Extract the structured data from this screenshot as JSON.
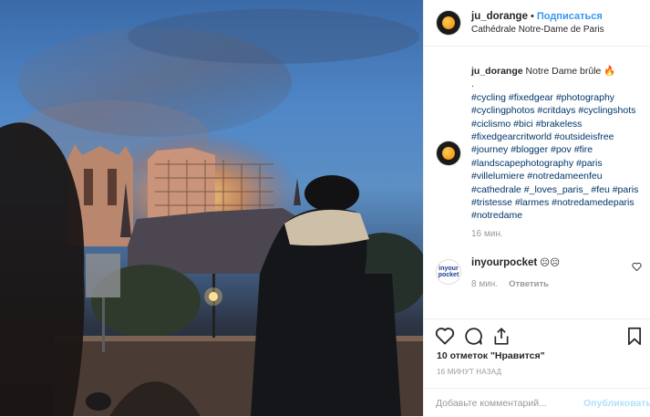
{
  "post": {
    "username": "ju_dorange",
    "separator": "•",
    "follow_label": "Подписаться",
    "location": "Cathédrale Notre-Dame de Paris"
  },
  "caption": {
    "username": "ju_dorange",
    "text": "Notre Dame brûle",
    "emoji": "🔥",
    "dot_line": ".",
    "hashtags": [
      "#cycling",
      "#fixedgear",
      "#photography",
      "#cyclingphotos",
      "#critdays",
      "#cyclingshots",
      "#ciclismo",
      "#bici",
      "#brakeless",
      "#fixedgearcritworld",
      "#outsideisfree",
      "#journey",
      "#blogger",
      "#pov",
      "#fire",
      "#landscapephotography",
      "#paris",
      "#villelumiere",
      "#notredameenfeu",
      "#cathedrale",
      "#_loves_paris_",
      "#feu",
      "#paris",
      "#tristesse",
      "#larmes",
      "#notredamedeparis",
      "#notredame"
    ],
    "time": "16 мин."
  },
  "comment": {
    "avatar_text": "inyour pocket",
    "username": "inyourpocket",
    "text": "☹☹",
    "time": "8 мин.",
    "reply_label": "Ответить"
  },
  "stats": {
    "likes": "10 отметок \"Нравится\"",
    "posted_ago": "16 МИНУТ НАЗАД"
  },
  "add_comment": {
    "placeholder": "Добавьте комментарий...",
    "publish_label": "Опубликовать"
  },
  "icons": {
    "like": "heart-icon",
    "comment": "comment-icon",
    "share": "share-icon",
    "save": "bookmark-icon"
  }
}
